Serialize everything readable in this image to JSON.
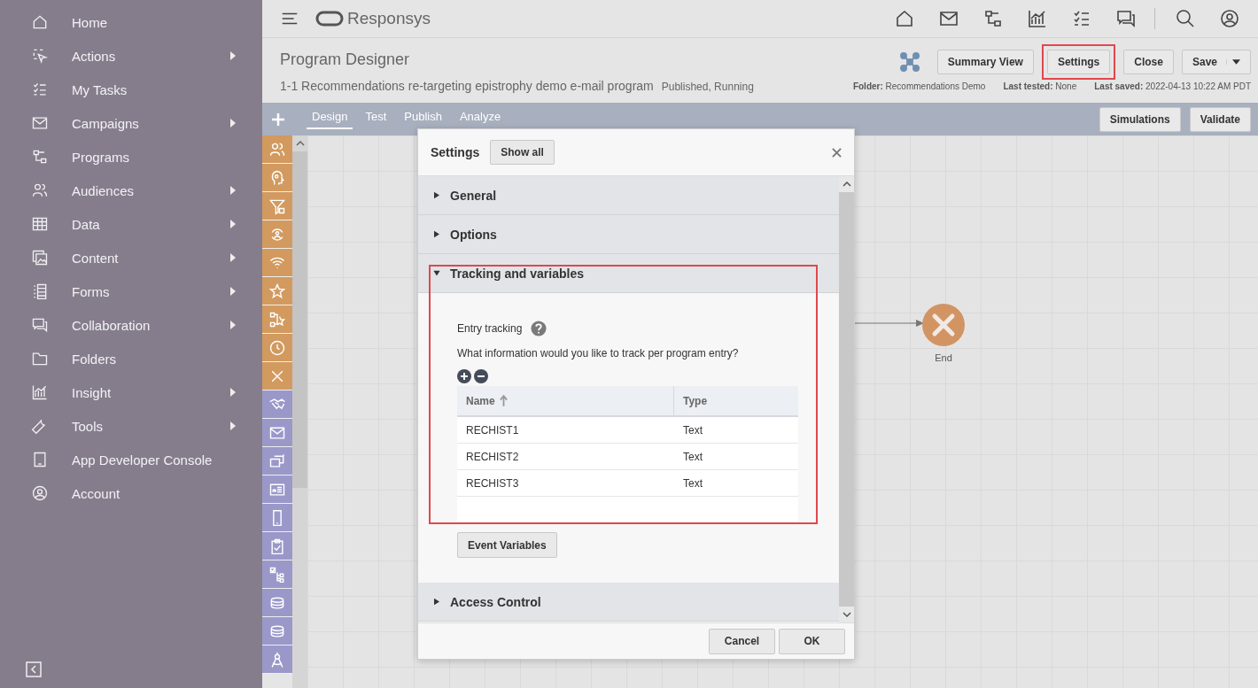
{
  "sidebar": {
    "items": [
      {
        "label": "Home",
        "submenu": false
      },
      {
        "label": "Actions",
        "submenu": true
      },
      {
        "label": "My Tasks",
        "submenu": false
      },
      {
        "label": "Campaigns",
        "submenu": true
      },
      {
        "label": "Programs",
        "submenu": false
      },
      {
        "label": "Audiences",
        "submenu": true
      },
      {
        "label": "Data",
        "submenu": true
      },
      {
        "label": "Content",
        "submenu": true
      },
      {
        "label": "Forms",
        "submenu": true
      },
      {
        "label": "Collaboration",
        "submenu": true
      },
      {
        "label": "Folders",
        "submenu": false
      },
      {
        "label": "Insight",
        "submenu": true
      },
      {
        "label": "Tools",
        "submenu": true
      },
      {
        "label": "App Developer Console",
        "submenu": false
      },
      {
        "label": "Account",
        "submenu": false
      }
    ]
  },
  "app": {
    "name": "Responsys"
  },
  "header": {
    "title": "Program Designer",
    "program_name": "1-1 Recommendations re-targeting epistrophy demo e-mail program",
    "status": "Published, Running",
    "buttons": [
      {
        "label": "Summary View",
        "highlighted": false
      },
      {
        "label": "Settings",
        "highlighted": true
      },
      {
        "label": "Close",
        "highlighted": false
      }
    ],
    "save_button": "Save",
    "meta": [
      {
        "label": "Folder:",
        "value": "Recommendations Demo"
      },
      {
        "label": "Last tested:",
        "value": "None"
      },
      {
        "label": "Last saved:",
        "value": "2022-04-13 10:22 AM PDT"
      }
    ]
  },
  "toolbar": {
    "tabs": [
      {
        "label": "Design",
        "selected": true
      },
      {
        "label": "Test",
        "selected": false
      },
      {
        "label": "Publish",
        "selected": false
      },
      {
        "label": "Analyze",
        "selected": false
      }
    ],
    "buttons": [
      "Simulations",
      "Validate"
    ]
  },
  "canvas": {
    "end_node": {
      "label": "End"
    }
  },
  "dialog": {
    "title": "Settings",
    "show_all": "Show all",
    "sections": [
      {
        "title": "General",
        "expanded": false,
        "highlighted": false
      },
      {
        "title": "Options",
        "expanded": false,
        "highlighted": false
      },
      {
        "title": "Tracking and variables",
        "expanded": true,
        "highlighted": true,
        "entry_tracking": "Entry tracking",
        "question": "What information would you like to track per program entry?",
        "columns": [
          {
            "label": "Name",
            "sorted": true
          },
          {
            "label": "Type",
            "sorted": false
          }
        ],
        "rows": [
          [
            "RECHIST1",
            "Text"
          ],
          [
            "RECHIST2",
            "Text"
          ],
          [
            "RECHIST3",
            "Text"
          ]
        ],
        "event_button": "Event Variables"
      },
      {
        "title": "Access Control",
        "expanded": false,
        "highlighted": false
      }
    ],
    "buttons": [
      "Cancel",
      "OK"
    ]
  }
}
